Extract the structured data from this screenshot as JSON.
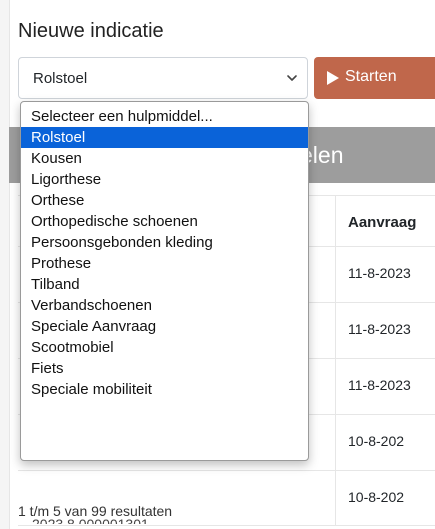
{
  "title": "Nieuwe indicatie",
  "select": {
    "value": "Rolstoel"
  },
  "start_button": {
    "label": "Starten"
  },
  "section": {
    "title_visible": "elen"
  },
  "table": {
    "header_right": "Aanvraag",
    "rows": [
      {
        "date": "11-8-2023"
      },
      {
        "date": "11-8-2023"
      },
      {
        "date": "11-8-2023"
      },
      {
        "date": "10-8-202"
      },
      {
        "date": "10-8-202"
      }
    ],
    "partial_text": "2023.8.000001301"
  },
  "results": "1 t/m 5 van 99 resultaten",
  "dropdown": {
    "options": [
      "Selecteer een hulpmiddel...",
      "Rolstoel",
      "Kousen",
      "Ligorthese",
      "Orthese",
      "Orthopedische schoenen",
      "Persoonsgebonden kleding",
      "Prothese",
      "Tilband",
      "Verbandschoenen",
      "Speciale Aanvraag",
      "Scootmobiel",
      "Fiets",
      "Speciale mobiliteit"
    ],
    "selected_index": 1
  },
  "colors": {
    "accent": "#c0674b",
    "selection": "#0a63d9",
    "section_bar": "#9d9d9d"
  }
}
